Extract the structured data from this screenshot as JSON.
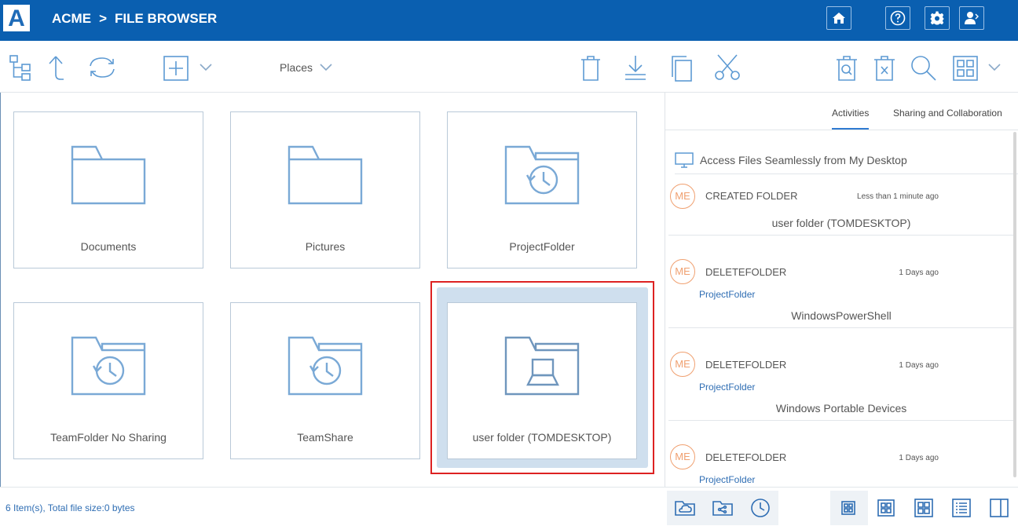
{
  "header": {
    "brand": "ACME",
    "separator": ">",
    "section": "FILE BROWSER",
    "logo_letter": "A",
    "buttons": [
      {
        "icon": "home-icon"
      },
      {
        "icon": "help-icon"
      },
      {
        "icon": "gear-icon"
      },
      {
        "icon": "user-icon"
      }
    ]
  },
  "toolbar": {
    "places_label": "Places",
    "icons": [
      "tree-view-icon",
      "up-arrow-icon",
      "sync-icon",
      "add-icon",
      "chevron-down-icon",
      "trash-icon",
      "download-icon",
      "copy-icon",
      "cut-icon",
      "trash-search-icon",
      "trash-clear-icon",
      "search-icon",
      "grid-view-icon",
      "chevron-down-icon"
    ]
  },
  "folders": [
    {
      "label": "Documents",
      "icon": "folder-icon"
    },
    {
      "label": "Pictures",
      "icon": "folder-icon"
    },
    {
      "label": "ProjectFolder",
      "icon": "folder-history-icon"
    },
    {
      "label": "TeamFolder No Sharing",
      "icon": "folder-history-icon"
    },
    {
      "label": "TeamShare",
      "icon": "folder-history-icon"
    },
    {
      "label": "user folder (TOMDESKTOP)",
      "icon": "folder-laptop-icon",
      "selected": true
    }
  ],
  "panel": {
    "tabs": [
      "Activities",
      "Sharing and Collaboration"
    ],
    "active_tab": "Activities",
    "promo": "Access Files Seamlessly from My Desktop",
    "activities": [
      {
        "avatar": "ME",
        "action": "CREATED FOLDER",
        "time": "Less than 1 minute ago",
        "link": "",
        "name": "user folder (TOMDESKTOP)"
      },
      {
        "avatar": "ME",
        "action": "DELETEFOLDER",
        "time": "1 Days ago",
        "link": "ProjectFolder",
        "name": "WindowsPowerShell"
      },
      {
        "avatar": "ME",
        "action": "DELETEFOLDER",
        "time": "1 Days ago",
        "link": "ProjectFolder",
        "name": "Windows Portable Devices"
      },
      {
        "avatar": "ME",
        "action": "DELETEFOLDER",
        "time": "1 Days ago",
        "link": "ProjectFolder",
        "name": ""
      }
    ]
  },
  "footer": {
    "status": "6 Item(s), Total file size:0 bytes"
  },
  "colors": {
    "header_bg": "#0a5fb0",
    "accent": "#5d9ad3",
    "selection_border": "#dd2222",
    "selection_bg": "#cfdfee",
    "avatar": "#f0a070"
  }
}
